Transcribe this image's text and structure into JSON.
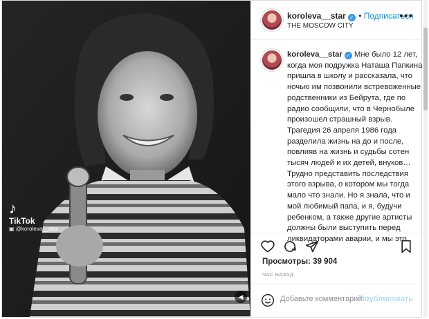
{
  "header": {
    "username": "koroleva__star",
    "follow_label": "Подписаться",
    "location": "THE MOSCOW CITY"
  },
  "caption": {
    "username": "koroleva__star",
    "text": "Мне было 12 лет, когда моя подружка Наташа Папкина пришла в школу и рассказала, что ночью им позвонили встревоженные родственники из Бейрута, где по радио сообщили, что в Чернобыле произошел страшный взрыв. Трагедия 26 апреля 1986 года разделила жизнь на до и после, повлияв на жизнь и судьбы сотен тысяч людей и их детей, внуков… Трудно представить последствия этого взрыва, о котором мы тогда мало что знали. Но я знала, что и мой любимый папа, и я, будучи ребенком, а также другие артисты должны были выступить перед ликвидаторами аварии, и мы это"
  },
  "stats": {
    "views": "Просмотры: 39 904",
    "time": "ЧАС НАЗАД"
  },
  "comment": {
    "placeholder": "Добавьте комментарий...",
    "publish_label": "Опубликовать"
  },
  "media": {
    "watermark": "TikTok",
    "watermark_user": "@koroleva__star"
  },
  "colors": {
    "accent": "#0095f6",
    "text": "#262626",
    "muted": "#8e8e8e"
  }
}
